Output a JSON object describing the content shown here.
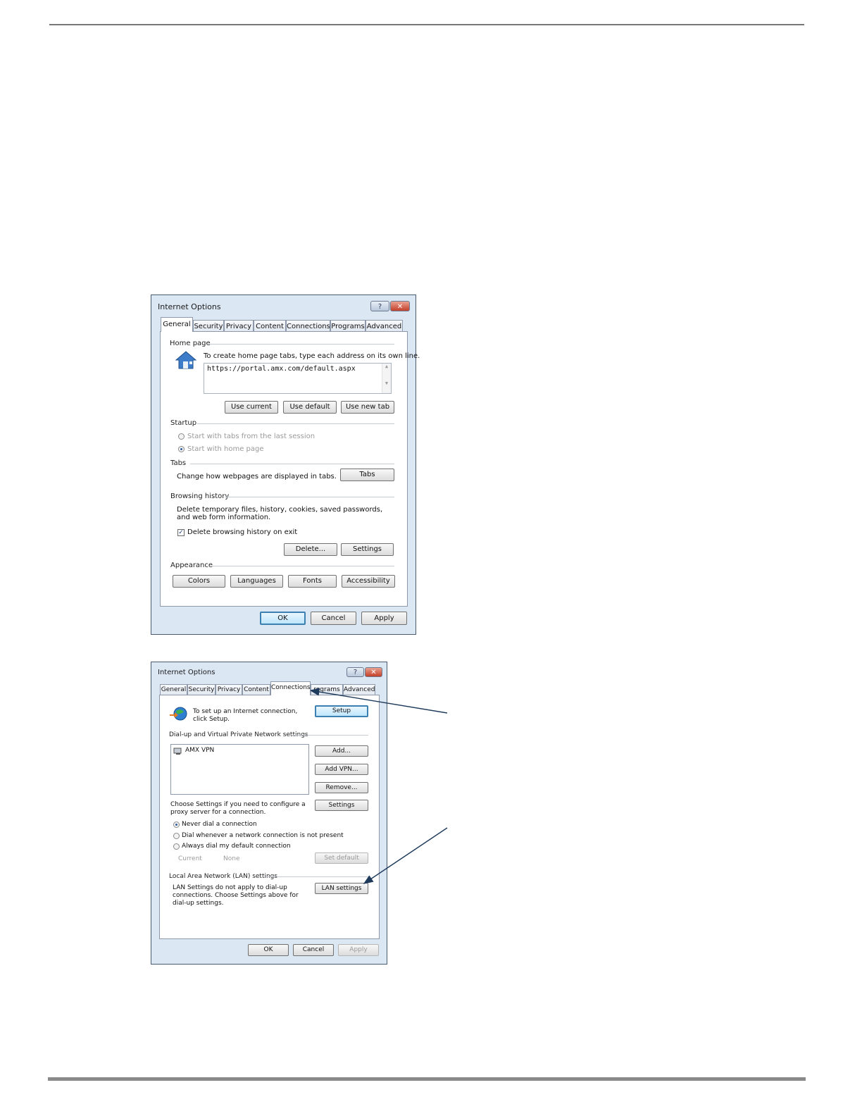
{
  "dialog1": {
    "title": "Internet Options",
    "help_glyph": "?",
    "close_glyph": "✕",
    "tabs": [
      "General",
      "Security",
      "Privacy",
      "Content",
      "Connections",
      "Programs",
      "Advanced"
    ],
    "active_tab": "General",
    "home_page": {
      "group": "Home page",
      "instruction": "To create home page tabs, type each address on its own line.",
      "url_value": "https://portal.amx.com/default.aspx",
      "buttons": [
        "Use current",
        "Use default",
        "Use new tab"
      ]
    },
    "startup": {
      "group": "Startup",
      "options": [
        "Start with tabs from the last session",
        "Start with home page"
      ],
      "selected": "Start with home page"
    },
    "tabs_section": {
      "group": "Tabs",
      "text": "Change how webpages are displayed in tabs.",
      "button": "Tabs"
    },
    "browsing_history": {
      "group": "Browsing history",
      "text": "Delete temporary files, history, cookies, saved passwords, and web form information.",
      "checkbox_label": "Delete browsing history on exit",
      "checked": true,
      "buttons": [
        "Delete...",
        "Settings"
      ]
    },
    "appearance": {
      "group": "Appearance",
      "buttons": [
        "Colors",
        "Languages",
        "Fonts",
        "Accessibility"
      ]
    },
    "footer": [
      "OK",
      "Cancel",
      "Apply"
    ]
  },
  "dialog2": {
    "title": "Internet Options",
    "help_glyph": "?",
    "close_glyph": "✕",
    "tabs": [
      "General",
      "Security",
      "Privacy",
      "Content",
      "Connections",
      "Programs",
      "Advanced"
    ],
    "visible_tab_text": [
      "General",
      "Security",
      "Privacy",
      "Content",
      "Connections",
      "rograms",
      "Advanced"
    ],
    "active_tab": "Connections",
    "setup_text": "To set up an Internet connection, click Setup.",
    "setup_button": "Setup",
    "dialup_group": "Dial-up and Virtual Private Network settings",
    "connections": [
      "AMX VPN"
    ],
    "side_buttons": [
      "Add...",
      "Add VPN...",
      "Remove...",
      "Settings"
    ],
    "proxy_text": "Choose Settings if you need to configure a proxy server for a connection.",
    "dial_options": [
      "Never dial a connection",
      "Dial whenever a network connection is not present",
      "Always dial my default connection"
    ],
    "dial_selected": "Never dial a connection",
    "current_label": "Current",
    "current_value": "None",
    "set_default_button": "Set default",
    "lan_group": "Local Area Network (LAN) settings",
    "lan_text": "LAN Settings do not apply to dial-up connections. Choose Settings above for dial-up settings.",
    "lan_button": "LAN settings",
    "footer": [
      "OK",
      "Cancel",
      "Apply"
    ],
    "apply_disabled": true
  },
  "colors": {
    "arrow": "#1f3b5c",
    "titlebar": "#dce7f4",
    "accent": "#3c7fb1"
  }
}
